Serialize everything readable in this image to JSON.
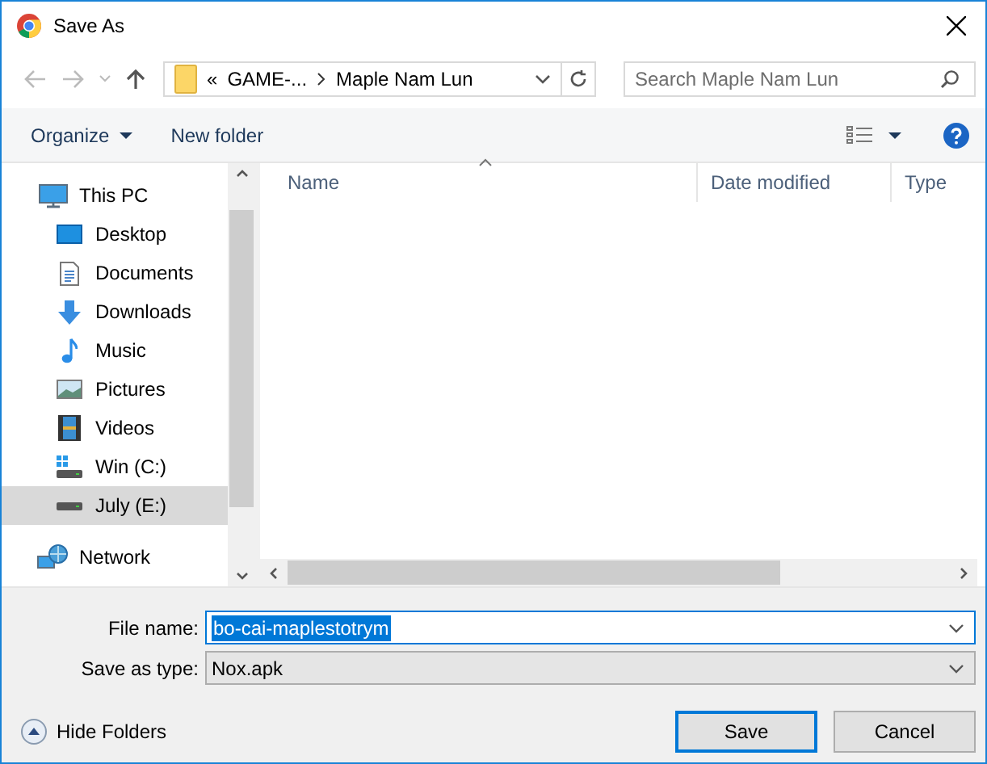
{
  "window": {
    "title": "Save As"
  },
  "address": {
    "overflow": "«",
    "crumbs": [
      "GAME-...",
      "Maple Nam Lun"
    ]
  },
  "search": {
    "placeholder": "Search Maple Nam Lun"
  },
  "toolbar": {
    "organize": "Organize",
    "new_folder": "New folder"
  },
  "sidebar": {
    "items": [
      {
        "label": "This PC",
        "kind": "computer",
        "selected": false,
        "children": [
          {
            "label": "Desktop",
            "kind": "desktop",
            "selected": false
          },
          {
            "label": "Documents",
            "kind": "documents",
            "selected": false
          },
          {
            "label": "Downloads",
            "kind": "downloads",
            "selected": false
          },
          {
            "label": "Music",
            "kind": "music",
            "selected": false
          },
          {
            "label": "Pictures",
            "kind": "pictures",
            "selected": false
          },
          {
            "label": "Videos",
            "kind": "videos",
            "selected": false
          },
          {
            "label": "Win (C:)",
            "kind": "system-drive",
            "selected": false
          },
          {
            "label": "July (E:)",
            "kind": "drive",
            "selected": true
          }
        ]
      },
      {
        "label": "Network",
        "kind": "network",
        "selected": false
      }
    ]
  },
  "table": {
    "columns": [
      "Name",
      "Date modified",
      "Type"
    ]
  },
  "form": {
    "file_name_label": "File name:",
    "file_name": "bo-cai-maplestotrym",
    "type_label": "Save as type:",
    "type": "Nox.apk"
  },
  "hide_folders": "Hide Folders",
  "buttons": [
    "Save",
    "Cancel"
  ]
}
